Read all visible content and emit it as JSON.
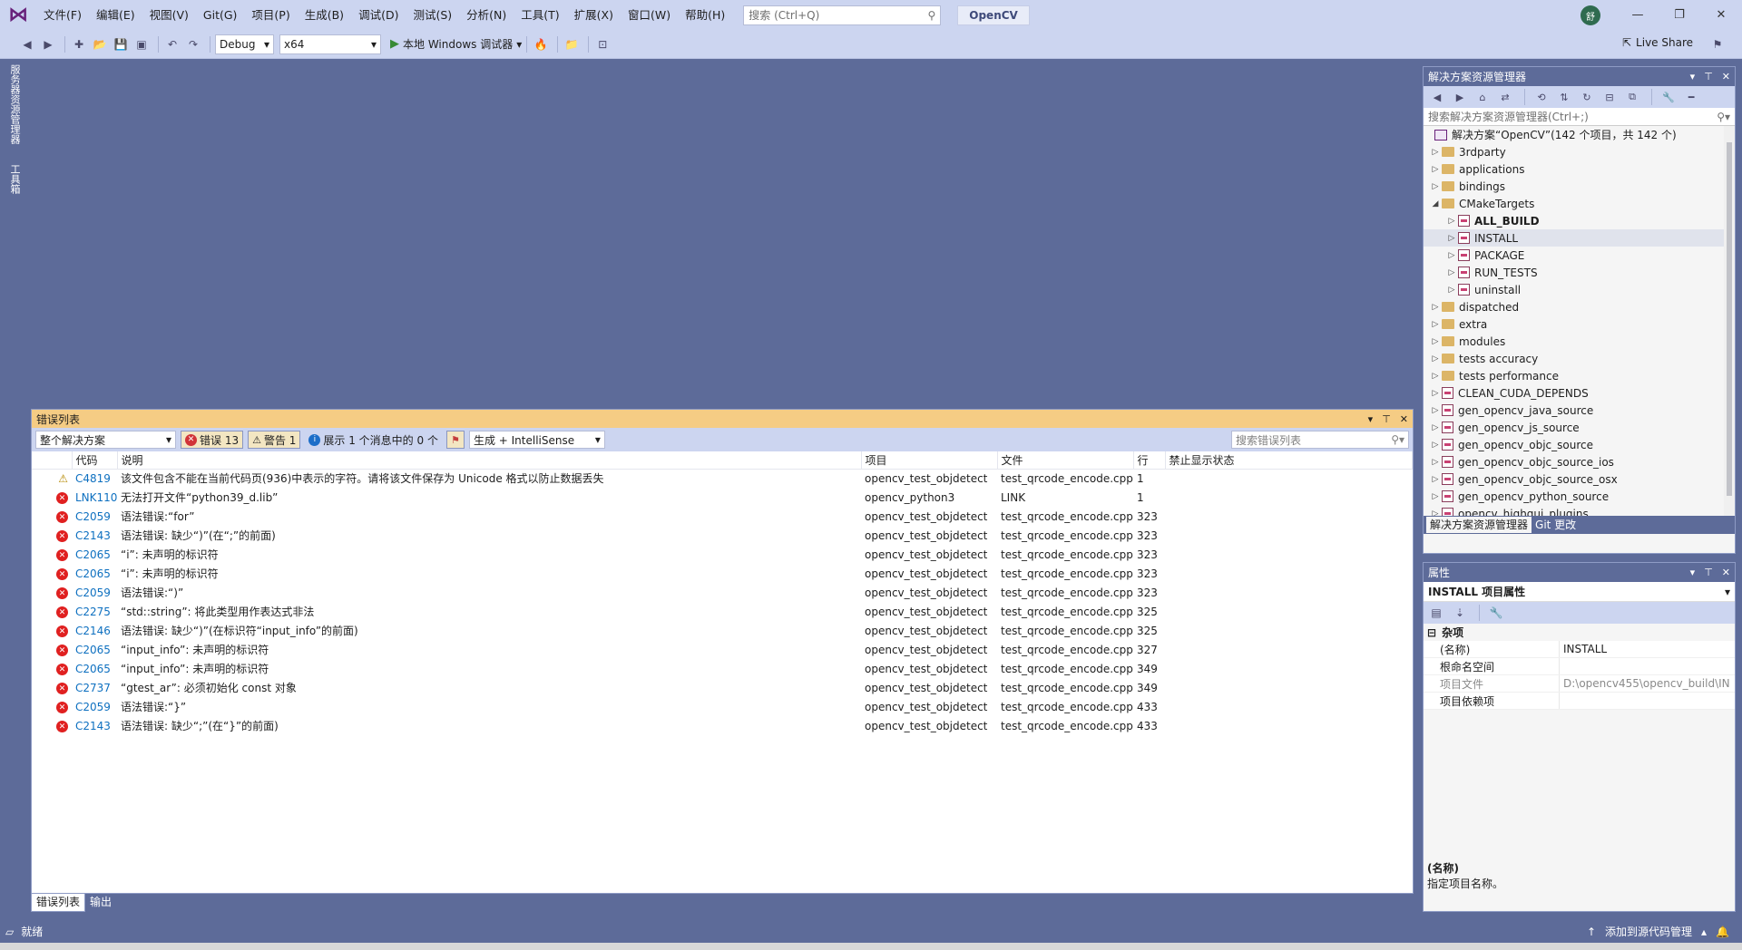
{
  "menu": [
    "文件(F)",
    "编辑(E)",
    "视图(V)",
    "Git(G)",
    "项目(P)",
    "生成(B)",
    "调试(D)",
    "测试(S)",
    "分析(N)",
    "工具(T)",
    "扩展(X)",
    "窗口(W)",
    "帮助(H)"
  ],
  "search": {
    "placeholder": "搜索 (Ctrl+Q)"
  },
  "solution_name": "OpenCV",
  "user_initials": "舒",
  "toolbar": {
    "config": "Debug",
    "platform": "x64",
    "run_label": "本地 Windows 调试器",
    "live_share": "Live Share"
  },
  "left_tabs": [
    "服务器资源管理器",
    "工具箱"
  ],
  "error_list": {
    "title": "错误列表",
    "scope": "整个解决方案",
    "errors_btn": "错误 13",
    "warnings_btn": "警告 1",
    "messages_btn": "展示 1 个消息中的 0 个",
    "source": "生成 + IntelliSense",
    "search_placeholder": "搜索错误列表",
    "columns": [
      "代码",
      "说明",
      "项目",
      "文件",
      "行",
      "禁止显示状态"
    ],
    "rows": [
      {
        "sev": "warning",
        "code": "C4819",
        "desc": "该文件包含不能在当前代码页(936)中表示的字符。请将该文件保存为 Unicode 格式以防止数据丢失",
        "project": "opencv_test_objdetect",
        "file": "test_qrcode_encode.cpp",
        "line": "1"
      },
      {
        "sev": "error",
        "code": "LNK1104",
        "desc": "无法打开文件“python39_d.lib”",
        "project": "opencv_python3",
        "file": "LINK",
        "line": "1"
      },
      {
        "sev": "error",
        "code": "C2059",
        "desc": "语法错误:“for”",
        "project": "opencv_test_objdetect",
        "file": "test_qrcode_encode.cpp",
        "line": "323"
      },
      {
        "sev": "error",
        "code": "C2143",
        "desc": "语法错误: 缺少“)”(在“;”的前面)",
        "project": "opencv_test_objdetect",
        "file": "test_qrcode_encode.cpp",
        "line": "323"
      },
      {
        "sev": "error",
        "code": "C2065",
        "desc": "“i”: 未声明的标识符",
        "project": "opencv_test_objdetect",
        "file": "test_qrcode_encode.cpp",
        "line": "323"
      },
      {
        "sev": "error",
        "code": "C2065",
        "desc": "“i”: 未声明的标识符",
        "project": "opencv_test_objdetect",
        "file": "test_qrcode_encode.cpp",
        "line": "323"
      },
      {
        "sev": "error",
        "code": "C2059",
        "desc": "语法错误:“)”",
        "project": "opencv_test_objdetect",
        "file": "test_qrcode_encode.cpp",
        "line": "323"
      },
      {
        "sev": "error",
        "code": "C2275",
        "desc": "“std::string”: 将此类型用作表达式非法",
        "project": "opencv_test_objdetect",
        "file": "test_qrcode_encode.cpp",
        "line": "325"
      },
      {
        "sev": "error",
        "code": "C2146",
        "desc": "语法错误: 缺少“)”(在标识符“input_info”的前面)",
        "project": "opencv_test_objdetect",
        "file": "test_qrcode_encode.cpp",
        "line": "325"
      },
      {
        "sev": "error",
        "code": "C2065",
        "desc": "“input_info”: 未声明的标识符",
        "project": "opencv_test_objdetect",
        "file": "test_qrcode_encode.cpp",
        "line": "327"
      },
      {
        "sev": "error",
        "code": "C2065",
        "desc": "“input_info”: 未声明的标识符",
        "project": "opencv_test_objdetect",
        "file": "test_qrcode_encode.cpp",
        "line": "349"
      },
      {
        "sev": "error",
        "code": "C2737",
        "desc": "“gtest_ar”: 必须初始化 const 对象",
        "project": "opencv_test_objdetect",
        "file": "test_qrcode_encode.cpp",
        "line": "349"
      },
      {
        "sev": "error",
        "code": "C2059",
        "desc": "语法错误:“}”",
        "project": "opencv_test_objdetect",
        "file": "test_qrcode_encode.cpp",
        "line": "433"
      },
      {
        "sev": "error",
        "code": "C2143",
        "desc": "语法错误: 缺少“;”(在“}”的前面)",
        "project": "opencv_test_objdetect",
        "file": "test_qrcode_encode.cpp",
        "line": "433"
      }
    ],
    "tabs": [
      "错误列表",
      "输出"
    ]
  },
  "solution_explorer": {
    "title": "解决方案资源管理器",
    "search_placeholder": "搜索解决方案资源管理器(Ctrl+;)",
    "items": [
      {
        "label": "解决方案“OpenCV”(142 个项目，共 142 个)",
        "level": 0,
        "type": "solution",
        "arrow": ""
      },
      {
        "label": "3rdparty",
        "level": 0,
        "type": "folder",
        "arrow": "▷"
      },
      {
        "label": "applications",
        "level": 0,
        "type": "folder",
        "arrow": "▷"
      },
      {
        "label": "bindings",
        "level": 0,
        "type": "folder",
        "arrow": "▷"
      },
      {
        "label": "CMakeTargets",
        "level": 0,
        "type": "folder",
        "arrow": "◢"
      },
      {
        "label": "ALL_BUILD",
        "level": 1,
        "type": "project",
        "arrow": "▷",
        "bold": true
      },
      {
        "label": "INSTALL",
        "level": 1,
        "type": "project",
        "arrow": "▷",
        "selected": true
      },
      {
        "label": "PACKAGE",
        "level": 1,
        "type": "project",
        "arrow": "▷"
      },
      {
        "label": "RUN_TESTS",
        "level": 1,
        "type": "project",
        "arrow": "▷"
      },
      {
        "label": "uninstall",
        "level": 1,
        "type": "project",
        "arrow": "▷"
      },
      {
        "label": "dispatched",
        "level": 0,
        "type": "folder",
        "arrow": "▷"
      },
      {
        "label": "extra",
        "level": 0,
        "type": "folder",
        "arrow": "▷"
      },
      {
        "label": "modules",
        "level": 0,
        "type": "folder",
        "arrow": "▷"
      },
      {
        "label": "tests accuracy",
        "level": 0,
        "type": "folder",
        "arrow": "▷"
      },
      {
        "label": "tests performance",
        "level": 0,
        "type": "folder",
        "arrow": "▷"
      },
      {
        "label": "CLEAN_CUDA_DEPENDS",
        "level": 0,
        "type": "project",
        "arrow": "▷"
      },
      {
        "label": "gen_opencv_java_source",
        "level": 0,
        "type": "project",
        "arrow": "▷"
      },
      {
        "label": "gen_opencv_js_source",
        "level": 0,
        "type": "project",
        "arrow": "▷"
      },
      {
        "label": "gen_opencv_objc_source",
        "level": 0,
        "type": "project",
        "arrow": "▷"
      },
      {
        "label": "gen_opencv_objc_source_ios",
        "level": 0,
        "type": "project",
        "arrow": "▷"
      },
      {
        "label": "gen_opencv_objc_source_osx",
        "level": 0,
        "type": "project",
        "arrow": "▷"
      },
      {
        "label": "gen_opencv_python_source",
        "level": 0,
        "type": "project",
        "arrow": "▷"
      },
      {
        "label": "opencv_highgui_plugins",
        "level": 0,
        "type": "project",
        "arrow": "▷"
      }
    ],
    "tabs": [
      "解决方案资源管理器",
      "Git 更改"
    ]
  },
  "properties": {
    "title": "属性",
    "object": "INSTALL 项目属性",
    "category": "杂项",
    "rows": [
      {
        "name": "(名称)",
        "value": "INSTALL",
        "dim": false
      },
      {
        "name": "根命名空间",
        "value": "",
        "dim": false
      },
      {
        "name": "项目文件",
        "value": "D:\\opencv455\\opencv_build\\IN",
        "dim": true
      },
      {
        "name": "项目依赖项",
        "value": "",
        "dim": false
      }
    ],
    "desc_title": "(名称)",
    "desc_text": "指定项目名称。"
  },
  "statusbar": {
    "left": "就绪",
    "right": "添加到源代码管理"
  }
}
